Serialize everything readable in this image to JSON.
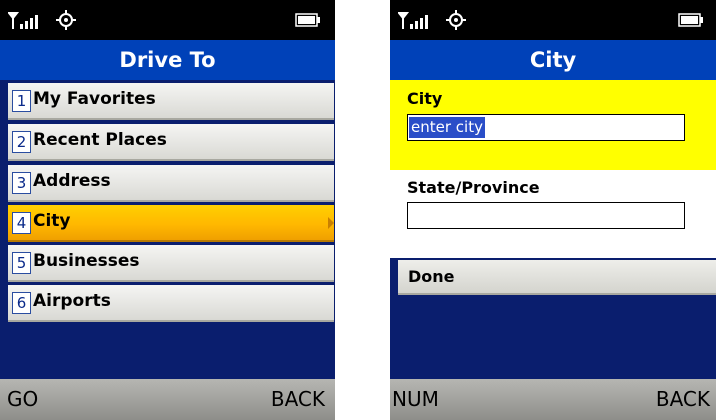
{
  "left_screen": {
    "title": "Drive To",
    "menu": [
      {
        "num": "1",
        "label": "My Favorites"
      },
      {
        "num": "2",
        "label": "Recent Places"
      },
      {
        "num": "3",
        "label": "Address"
      },
      {
        "num": "4",
        "label": "City",
        "selected": true
      },
      {
        "num": "5",
        "label": "Businesses"
      },
      {
        "num": "6",
        "label": "Airports"
      }
    ],
    "softkeys": {
      "left": "GO",
      "right": "BACK"
    }
  },
  "right_screen": {
    "title": "City",
    "city_label": "City",
    "city_value": "enter city",
    "state_label": "State/Province",
    "state_value": "",
    "done_label": "Done",
    "softkeys": {
      "left": "NUM",
      "right": "BACK"
    }
  },
  "icons": {
    "signal": "signal-strength-icon",
    "settings": "gear-icon",
    "battery": "battery-icon"
  },
  "colors": {
    "title_bar": "#0041b8",
    "highlight": "#ffc000",
    "focus_field": "#ffff00",
    "background_navy": "#0a1e6e"
  }
}
